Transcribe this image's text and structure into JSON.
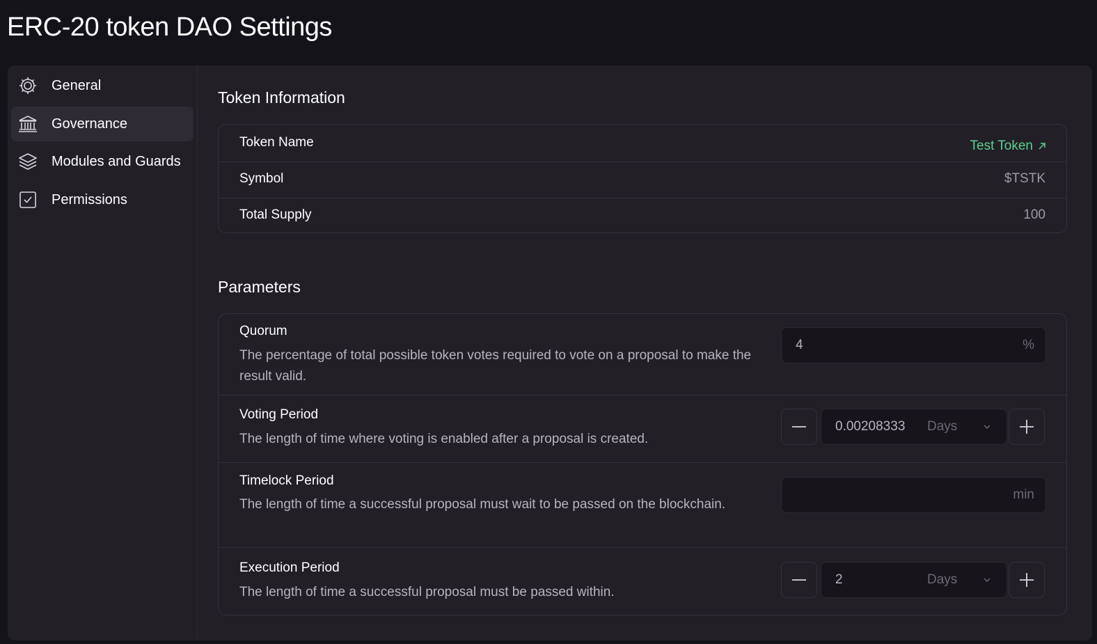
{
  "page": {
    "title": "ERC-20 token DAO Settings"
  },
  "sidebar": {
    "items": [
      {
        "label": "General",
        "icon": "gear-icon"
      },
      {
        "label": "Governance",
        "icon": "bank-icon",
        "active": true
      },
      {
        "label": "Modules and Guards",
        "icon": "layers-icon"
      },
      {
        "label": "Permissions",
        "icon": "checkbox-icon"
      }
    ]
  },
  "token_info": {
    "title": "Token Information",
    "rows": [
      {
        "label": "Token Name",
        "value": "Test Token"
      },
      {
        "label": "Symbol",
        "value": "$TSTK"
      },
      {
        "label": "Total Supply",
        "value": "100"
      }
    ]
  },
  "parameters": {
    "title": "Parameters",
    "quorum": {
      "label": "Quorum",
      "description": "The percentage of total possible token votes required to vote on a proposal to make the result valid.",
      "value": "4",
      "suffix": "%"
    },
    "voting_period": {
      "label": "Voting Period",
      "description": "The length of time where voting is enabled after a proposal is created.",
      "value": "0.00208333",
      "unit": "Days"
    },
    "timelock_period": {
      "label": "Timelock Period",
      "description": "The length of time a successful proposal must wait to be passed on the blockchain.",
      "value": "",
      "suffix": "min"
    },
    "execution_period": {
      "label": "Execution Period",
      "description": "The length of time a successful proposal must be passed within.",
      "value": "2",
      "unit": "Days"
    }
  },
  "colors": {
    "background": "#15131a",
    "panel": "#221f27",
    "link": "#5dcf8f",
    "muted_text": "#b8b3bf"
  }
}
